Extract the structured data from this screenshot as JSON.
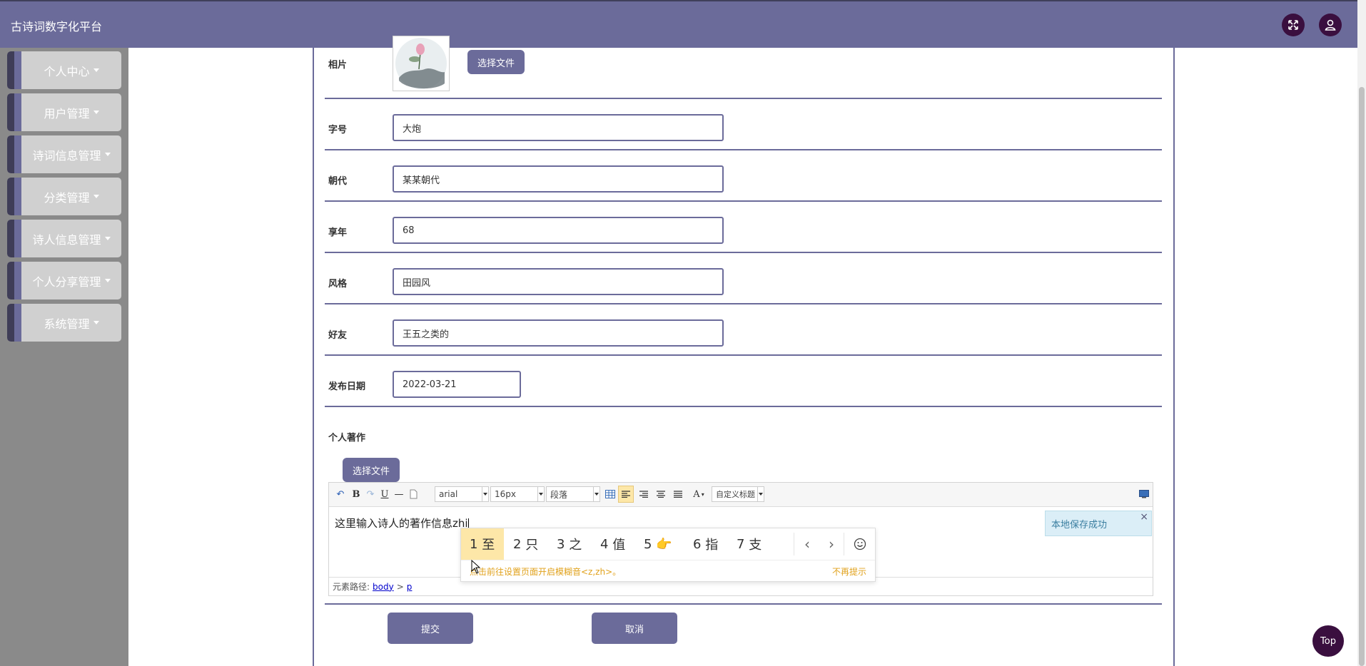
{
  "app": {
    "title": "古诗词数字化平台"
  },
  "header": {
    "icons": [
      "fullscreen-icon",
      "user-icon"
    ]
  },
  "sidebar": {
    "items": [
      {
        "label": "个人中心"
      },
      {
        "label": "用户管理"
      },
      {
        "label": "诗词信息管理"
      },
      {
        "label": "分类管理"
      },
      {
        "label": "诗人信息管理"
      },
      {
        "label": "个人分享管理"
      },
      {
        "label": "系统管理"
      }
    ]
  },
  "form": {
    "photo_label": "相片",
    "choose_file_label": "选择文件",
    "fields": {
      "zihao": {
        "label": "字号",
        "value": "大炮"
      },
      "dynasty": {
        "label": "朝代",
        "value": "某某朝代"
      },
      "age": {
        "label": "享年",
        "value": "68"
      },
      "style": {
        "label": "风格",
        "value": "田园风"
      },
      "friends": {
        "label": "好友",
        "value": "王五之类的"
      },
      "publish_date": {
        "label": "发布日期",
        "value": "2022-03-21"
      }
    },
    "works_label": "个人著作",
    "submit_label": "提交",
    "cancel_label": "取消"
  },
  "editor": {
    "toolbar": {
      "bold": "B",
      "underline": "U",
      "font": "arial",
      "size": "16px",
      "paragraph": "段落",
      "font_color": "A",
      "custom_title": "自定义标题"
    },
    "content": "这里输入诗人的著作信息zhi",
    "path_label": "元素路径:",
    "path_body": "body",
    "path_sep": ">",
    "path_p": "p",
    "toast": "本地保存成功",
    "toast_close": "×"
  },
  "ime": {
    "candidates": [
      {
        "num": "1",
        "text": "至"
      },
      {
        "num": "2",
        "text": "只"
      },
      {
        "num": "3",
        "text": "之"
      },
      {
        "num": "4",
        "text": "值"
      },
      {
        "num": "5",
        "text": "👉"
      },
      {
        "num": "6",
        "text": "指"
      },
      {
        "num": "7",
        "text": "支"
      }
    ],
    "hint": "点击前往设置页面开启模糊音<z,zh>。",
    "dismiss": "不再提示"
  },
  "back_to_top": "Top",
  "colors": {
    "primary": "#6b6b9a",
    "dark_accent": "#3a0f3f",
    "sidebar_bg": "#8a8a8a"
  }
}
